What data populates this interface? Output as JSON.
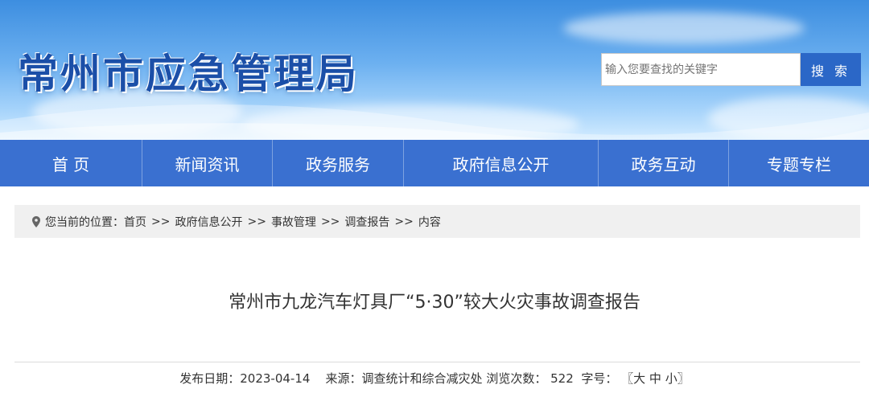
{
  "header": {
    "site_title": "常州市应急管理局",
    "search": {
      "placeholder": "输入您要查找的关键字",
      "button_label": "搜 索"
    }
  },
  "nav": {
    "items": [
      "首 页",
      "新闻资讯",
      "政务服务",
      "政府信息公开",
      "政务互动",
      "专题专栏"
    ]
  },
  "breadcrumb": {
    "label": "您当前的位置：",
    "items": [
      "首页",
      "政府信息公开",
      "事故管理",
      "调查报告",
      "内容"
    ],
    "separator": ">>"
  },
  "article": {
    "title": "常州市九龙汽车灯具厂“5·30”较大火灾事故调查报告",
    "meta": {
      "date_label": "发布日期：",
      "date": "2023-04-14",
      "source_label": "来源：",
      "source": "调查统计和综合减灾处",
      "views_label": "浏览次数：",
      "views": "522",
      "font_label": "字号：",
      "bracket_open": "〖",
      "size_large": "大",
      "size_medium": "中",
      "size_small": "小",
      "bracket_close": "〗"
    }
  },
  "colors": {
    "brand_blue": "#3a70d0",
    "title_blue": "#1b4fa8",
    "search_button": "#2b67c7"
  }
}
